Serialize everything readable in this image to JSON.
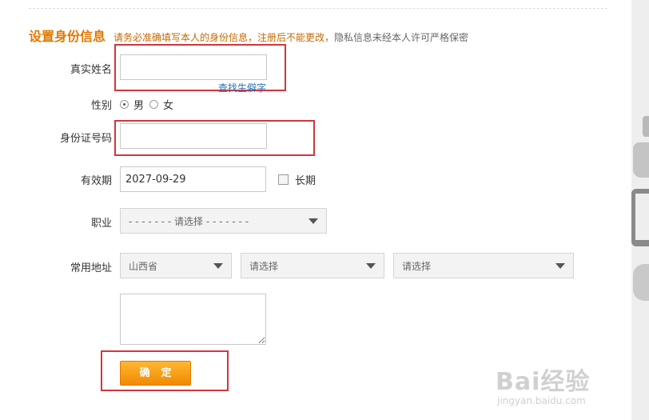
{
  "heading": {
    "title": "设置身份信息",
    "notice_warning": "请务必准确填写本人的身份信息，注册后不能更改，",
    "notice_rest": "隐私信息未经本人许可严格保密"
  },
  "fields": {
    "name_label": "真实姓名",
    "name_value": "",
    "rare_char_link": "查找生僻字",
    "gender_label": "性别",
    "gender_male": "男",
    "gender_female": "女",
    "id_label": "身份证号码",
    "id_value": "",
    "validity_label": "有效期",
    "validity_value": "2027-09-29",
    "long_term_label": "长期",
    "occupation_label": "职业",
    "occupation_value": "- - - - - - - 请选择 - - - - - - -",
    "address_label": "常用地址",
    "province_value": "山西省",
    "city_value": "请选择",
    "district_value": "请选择",
    "address_detail": ""
  },
  "submit_label": "确定",
  "watermark": {
    "brand": "Bai经验",
    "url": "jingyan.baidu.com"
  },
  "colors": {
    "accent": "#e07800",
    "highlight_box": "#d1363d",
    "button": "#f29400",
    "link": "#2a6fb5"
  }
}
